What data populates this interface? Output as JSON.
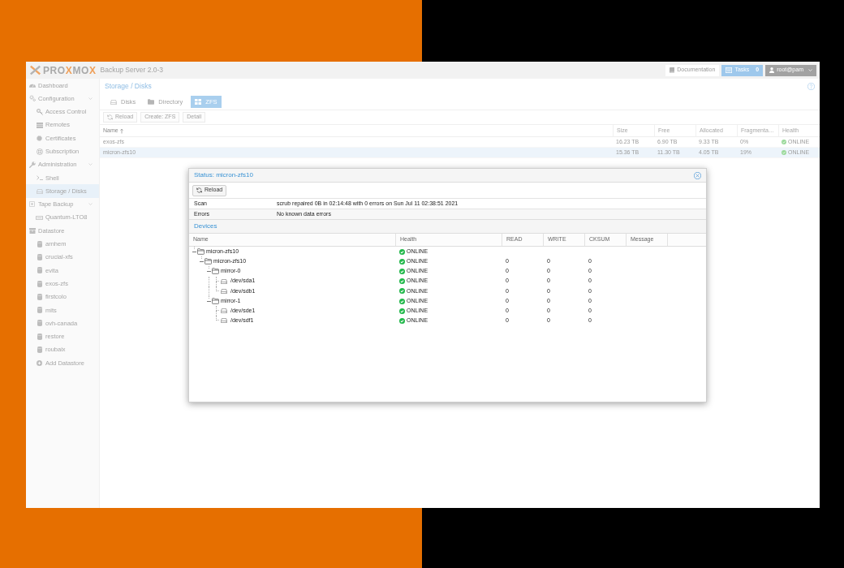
{
  "header": {
    "logo": [
      {
        "text": "PRO",
        "accent": false
      },
      {
        "text": "X",
        "accent": true
      },
      {
        "text": "MO",
        "accent": false
      },
      {
        "text": "X",
        "accent": true
      }
    ],
    "product": "Backup Server 2.0-3",
    "buttons": [
      {
        "kind": "docs",
        "label": "Documentation"
      },
      {
        "kind": "tasks",
        "label": "Tasks",
        "count": "0"
      },
      {
        "kind": "user",
        "label": "root@pam"
      }
    ]
  },
  "sidebar": {
    "items": [
      {
        "label": "Dashboard",
        "kind": "dashboard",
        "selected": false
      },
      {
        "label": "Configuration",
        "kind": "configuration",
        "selected": false,
        "expanded": true,
        "children": [
          {
            "label": "Access Control",
            "kind": "access",
            "selected": false
          },
          {
            "label": "Remotes",
            "kind": "remotes",
            "selected": false
          },
          {
            "label": "Certificates",
            "kind": "certificates",
            "selected": false
          },
          {
            "label": "Subscription",
            "kind": "subscription",
            "selected": false
          }
        ]
      },
      {
        "label": "Administration",
        "kind": "administration",
        "selected": false,
        "expanded": true,
        "children": [
          {
            "label": "Shell",
            "kind": "shell",
            "selected": false
          },
          {
            "label": "Storage / Disks",
            "kind": "storage",
            "selected": true
          }
        ]
      },
      {
        "label": "Tape Backup",
        "kind": "tape",
        "selected": false,
        "expanded": true,
        "children": [
          {
            "label": "Quantum-LTO8",
            "kind": "drive",
            "selected": false
          }
        ]
      },
      {
        "label": "Datastore",
        "kind": "datastores",
        "selected": false,
        "children": [
          {
            "label": "arnhem",
            "kind": "store",
            "selected": false
          },
          {
            "label": "crucial-xfs",
            "kind": "store",
            "selected": false
          },
          {
            "label": "evita",
            "kind": "store",
            "selected": false
          },
          {
            "label": "exos-zfs",
            "kind": "store",
            "selected": false
          },
          {
            "label": "firstcolo",
            "kind": "store",
            "selected": false
          },
          {
            "label": "mits",
            "kind": "store",
            "selected": false
          },
          {
            "label": "ovh-canada",
            "kind": "store",
            "selected": false
          },
          {
            "label": "restore",
            "kind": "store",
            "selected": false
          },
          {
            "label": "roubaix",
            "kind": "store",
            "selected": false
          },
          {
            "label": "Add Datastore",
            "kind": "add",
            "selected": false
          }
        ]
      }
    ]
  },
  "main": {
    "title": "Storage / Disks",
    "tabs": [
      {
        "label": "Disks",
        "kind": "disks",
        "selected": false
      },
      {
        "label": "Directory",
        "kind": "directory",
        "selected": false
      },
      {
        "label": "ZFS",
        "kind": "zfs",
        "selected": true
      }
    ],
    "toolbar": [
      {
        "kind": "reload",
        "label": "Reload"
      },
      {
        "kind": "plain",
        "label": "Create: ZFS"
      },
      {
        "kind": "plain",
        "label": "Detail"
      }
    ],
    "pools": {
      "columns": [
        {
          "label": "Name",
          "sorted": true
        },
        {
          "label": "Size",
          "sorted": false
        },
        {
          "label": "Free",
          "sorted": false
        },
        {
          "label": "Allocated",
          "sorted": false
        },
        {
          "label": "Fragmenta…",
          "sorted": false
        },
        {
          "label": "Health",
          "sorted": false
        }
      ],
      "rows": [
        {
          "cells": [
            "exos-zfs",
            "16.23 TB",
            "6.90 TB",
            "9.33 TB",
            "0%"
          ],
          "health": "ONLINE",
          "selected": false
        },
        {
          "cells": [
            "micron-zfs10",
            "15.36 TB",
            "11.30 TB",
            "4.05 TB",
            "19%"
          ],
          "health": "ONLINE",
          "selected": true
        }
      ]
    }
  },
  "dialog": {
    "title": "Status: micron-zfs10",
    "toolbar": [
      {
        "kind": "reload",
        "label": "Reload"
      }
    ],
    "details": [
      {
        "key": "Scan",
        "value": "scrub repaired 0B in 02:14:48 with 0 errors on Sun Jul 11 02:38:51 2021"
      },
      {
        "key": "Errors",
        "value": "No known data errors"
      }
    ],
    "devices": {
      "title": "Devices",
      "columns": [
        "Name",
        "Health",
        "READ",
        "WRITE",
        "CKSUM",
        "Message"
      ],
      "tree": [
        {
          "name": "micron-zfs10",
          "kind": "vdev",
          "expanded": true,
          "health": "ONLINE",
          "children": [
            {
              "name": "micron-zfs10",
              "kind": "vdev",
              "expanded": true,
              "health": "ONLINE",
              "read": "0",
              "write": "0",
              "cksum": "0",
              "children": [
                {
                  "name": "mirror-0",
                  "kind": "vdev",
                  "expanded": true,
                  "health": "ONLINE",
                  "read": "0",
                  "write": "0",
                  "cksum": "0",
                  "children": [
                    {
                      "name": "/dev/sda1",
                      "kind": "disk",
                      "health": "ONLINE",
                      "read": "0",
                      "write": "0",
                      "cksum": "0"
                    },
                    {
                      "name": "/dev/sdb1",
                      "kind": "disk",
                      "health": "ONLINE",
                      "read": "0",
                      "write": "0",
                      "cksum": "0"
                    }
                  ]
                },
                {
                  "name": "mirror-1",
                  "kind": "vdev",
                  "expanded": true,
                  "health": "ONLINE",
                  "read": "0",
                  "write": "0",
                  "cksum": "0",
                  "children": [
                    {
                      "name": "/dev/sde1",
                      "kind": "disk",
                      "health": "ONLINE",
                      "read": "0",
                      "write": "0",
                      "cksum": "0"
                    },
                    {
                      "name": "/dev/sdf1",
                      "kind": "disk",
                      "health": "ONLINE",
                      "read": "0",
                      "write": "0",
                      "cksum": "0"
                    }
                  ]
                }
              ]
            }
          ]
        }
      ]
    }
  }
}
